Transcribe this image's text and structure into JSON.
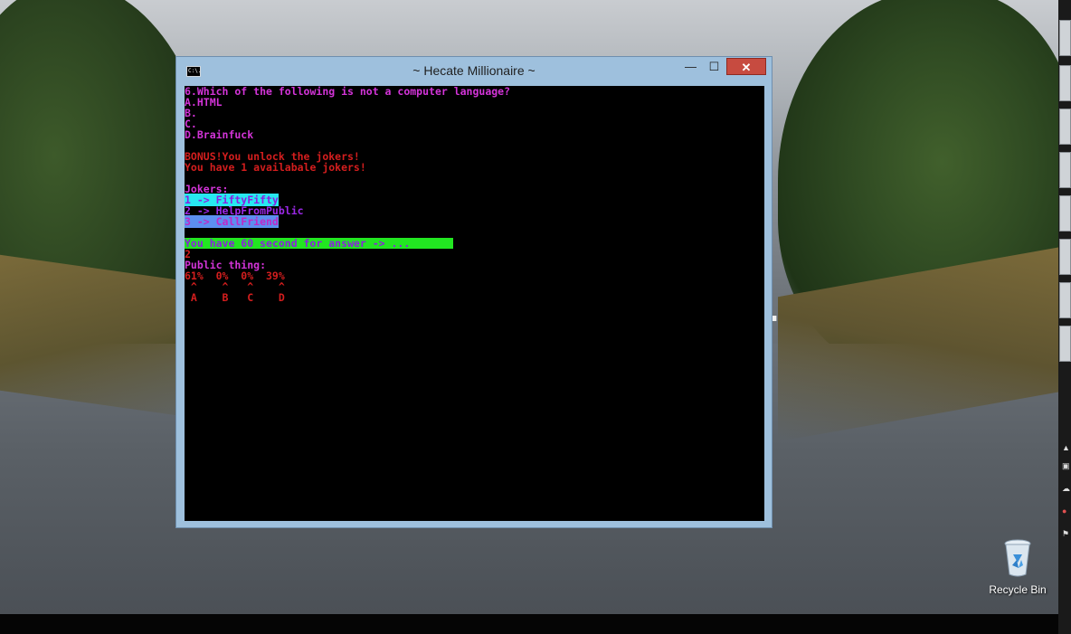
{
  "window": {
    "title": "~ Hecate Millionaire ~",
    "icon_label": "C:\\.",
    "min_glyph": "—",
    "max_glyph": "☐",
    "close_glyph": "✕"
  },
  "console": {
    "question": "6.Which of the following is not a computer language?",
    "option_a": "A.HTML",
    "option_b": "B.",
    "option_c": "C.",
    "option_d": "D.Brainfuck",
    "bonus_line1": "BONUS!You unlock the jokers!",
    "bonus_line2": "You have 1 availabale jokers!",
    "jokers_header": "Jokers:",
    "joker1": "1 -> FiftyFifty",
    "joker2": "2 -> HelpFromPublic",
    "joker3": "3 -> CallFriend",
    "timer": "You have 60 second for answer -> ...",
    "input": "2",
    "public_header": "Public thing:",
    "percents": "61%  0%  0%  39%",
    "carets": " ^    ^   ^    ^",
    "letters": " A    B   C    D"
  },
  "desktop": {
    "recycle_bin_label": "Recycle Bin",
    "wallpaper_mark": "."
  },
  "colors": {
    "console_bg": "#000000",
    "magenta": "#d334d8",
    "red": "#d41e1e",
    "cyan_highlight": "#27e8f0",
    "green_highlight": "#22e621",
    "blue_highlight": "#5c8ff0",
    "window_frame": "#9ec0dd",
    "close_button": "#c74b40"
  }
}
